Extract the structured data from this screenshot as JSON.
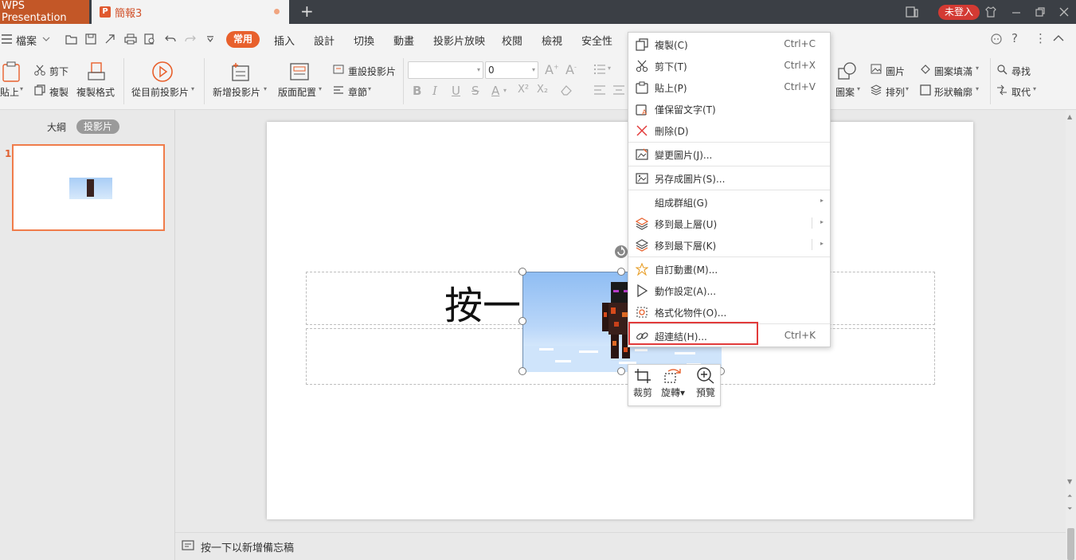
{
  "titlebar": {
    "app_tab": "WPS Presentation",
    "doc_tab": "簡報3",
    "doc_icon": "P",
    "login": "未登入"
  },
  "menu": {
    "file": "檔案",
    "items": [
      "常用",
      "插入",
      "設計",
      "切換",
      "動畫",
      "投影片放映",
      "校閱",
      "檢視",
      "安全性"
    ]
  },
  "ribbon": {
    "paste": "貼上",
    "cut": "剪下",
    "copy": "複製",
    "format_painter": "複製格式",
    "from_current": "從目前投影片",
    "new_slide": "新增投影片",
    "layout": "版面配置",
    "reset_slide": "重設投影片",
    "section": "章節",
    "font_size": "0",
    "shape": "圖案",
    "picture": "圖片",
    "arrange": "排列",
    "fill": "圖案填滿",
    "outline": "形狀輪廓",
    "find": "尋找",
    "replace": "取代"
  },
  "left_panel": {
    "tab_outline": "大綱",
    "tab_slides": "投影片",
    "slide_number": "1"
  },
  "slide": {
    "title_text": "按一"
  },
  "float_toolbar": {
    "crop": "裁剪",
    "rotate": "旋轉",
    "preview": "預覽"
  },
  "context_menu": {
    "copy": {
      "label": "複製(C)",
      "shortcut": "Ctrl+C"
    },
    "cut": {
      "label": "剪下(T)",
      "shortcut": "Ctrl+X"
    },
    "paste": {
      "label": "貼上(P)",
      "shortcut": "Ctrl+V"
    },
    "keep_text": {
      "label": "僅保留文字(T)"
    },
    "delete": {
      "label": "刪除(D)"
    },
    "change_picture": {
      "label": "變更圖片(J)..."
    },
    "save_as_picture": {
      "label": "另存成圖片(S)..."
    },
    "group": {
      "label": "組成群組(G)"
    },
    "bring_to_front": {
      "label": "移到最上層(U)"
    },
    "send_to_back": {
      "label": "移到最下層(K)"
    },
    "custom_animation": {
      "label": "自訂動畫(M)..."
    },
    "action_settings": {
      "label": "動作設定(A)..."
    },
    "format_object": {
      "label": "格式化物件(O)..."
    },
    "hyperlink": {
      "label": "超連結(H)...",
      "shortcut": "Ctrl+K"
    }
  },
  "status": {
    "notes_placeholder": "按一下以新增備忘稿"
  },
  "colors": {
    "accent": "#e8602c",
    "titlebar": "#3b3f45",
    "highlight_box": "#e23b3b"
  }
}
